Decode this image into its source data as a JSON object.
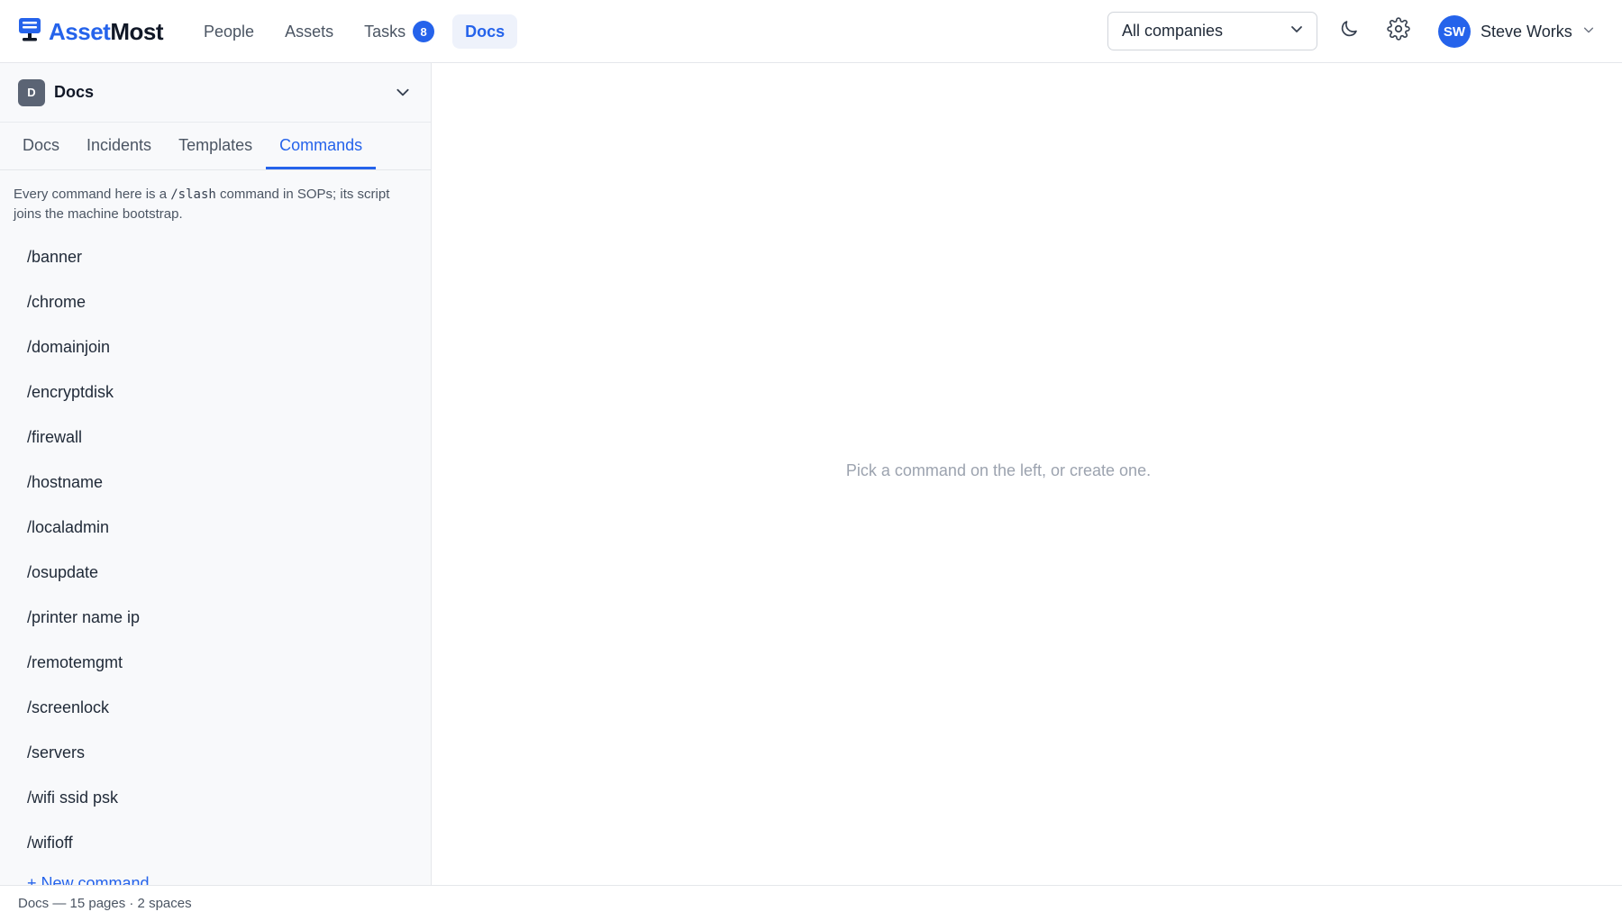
{
  "brand": {
    "name_part1": "Asset",
    "name_part2": "Most",
    "logo_icon": "monitor-logo-icon"
  },
  "nav": {
    "items": [
      {
        "label": "People",
        "active": false
      },
      {
        "label": "Assets",
        "active": false
      },
      {
        "label": "Tasks",
        "active": false,
        "badge": "8"
      },
      {
        "label": "Docs",
        "active": true
      }
    ]
  },
  "company_select": {
    "value": "All companies",
    "icon": "chevron-down-icon"
  },
  "header_icons": {
    "theme": "moon-icon",
    "settings": "gear-icon"
  },
  "user": {
    "initials": "SW",
    "name": "Steve Works"
  },
  "sidebar": {
    "space": {
      "badge": "D",
      "title": "Docs"
    },
    "tabs": [
      {
        "label": "Docs",
        "active": false
      },
      {
        "label": "Incidents",
        "active": false
      },
      {
        "label": "Templates",
        "active": false
      },
      {
        "label": "Commands",
        "active": true
      }
    ],
    "hint": {
      "before": "Every command here is a ",
      "code": "/slash",
      "after": " command in SOPs; its script joins the machine bootstrap."
    },
    "commands": [
      "/banner",
      "/chrome",
      "/domainjoin",
      "/encryptdisk",
      "/firewall",
      "/hostname",
      "/localadmin",
      "/osupdate",
      "/printer name ip",
      "/remotemgmt",
      "/screenlock",
      "/servers",
      "/wifi ssid psk",
      "/wifioff"
    ],
    "new_command_label": "+ New command"
  },
  "main": {
    "empty_message": "Pick a command on the left, or create one."
  },
  "footer": {
    "status": "Docs — 15 pages · 2 spaces"
  },
  "colors": {
    "accent": "#2563eb",
    "sidebar_bg": "#f8f9fb",
    "muted_text": "#9ca3af"
  }
}
